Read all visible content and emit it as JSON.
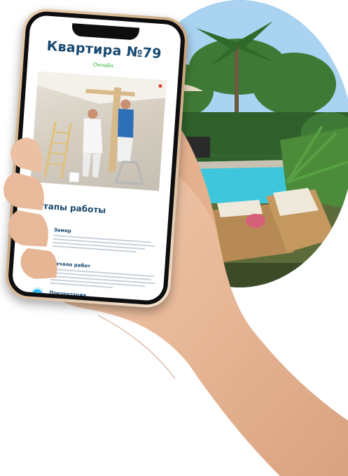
{
  "apartment": {
    "title": "Квартира №79",
    "status": "Онлайн",
    "status_color": "#3cb53c"
  },
  "stages": {
    "title": "Этапы работы",
    "items": [
      {
        "num": "01",
        "name": "Замер"
      },
      {
        "num": "02",
        "name": "Начало работ"
      },
      {
        "num": "03",
        "name": "Презентация"
      }
    ]
  },
  "colors": {
    "accent": "#29b6f6",
    "heading": "#17486f"
  },
  "icons": {
    "live": "record-dot-icon"
  }
}
